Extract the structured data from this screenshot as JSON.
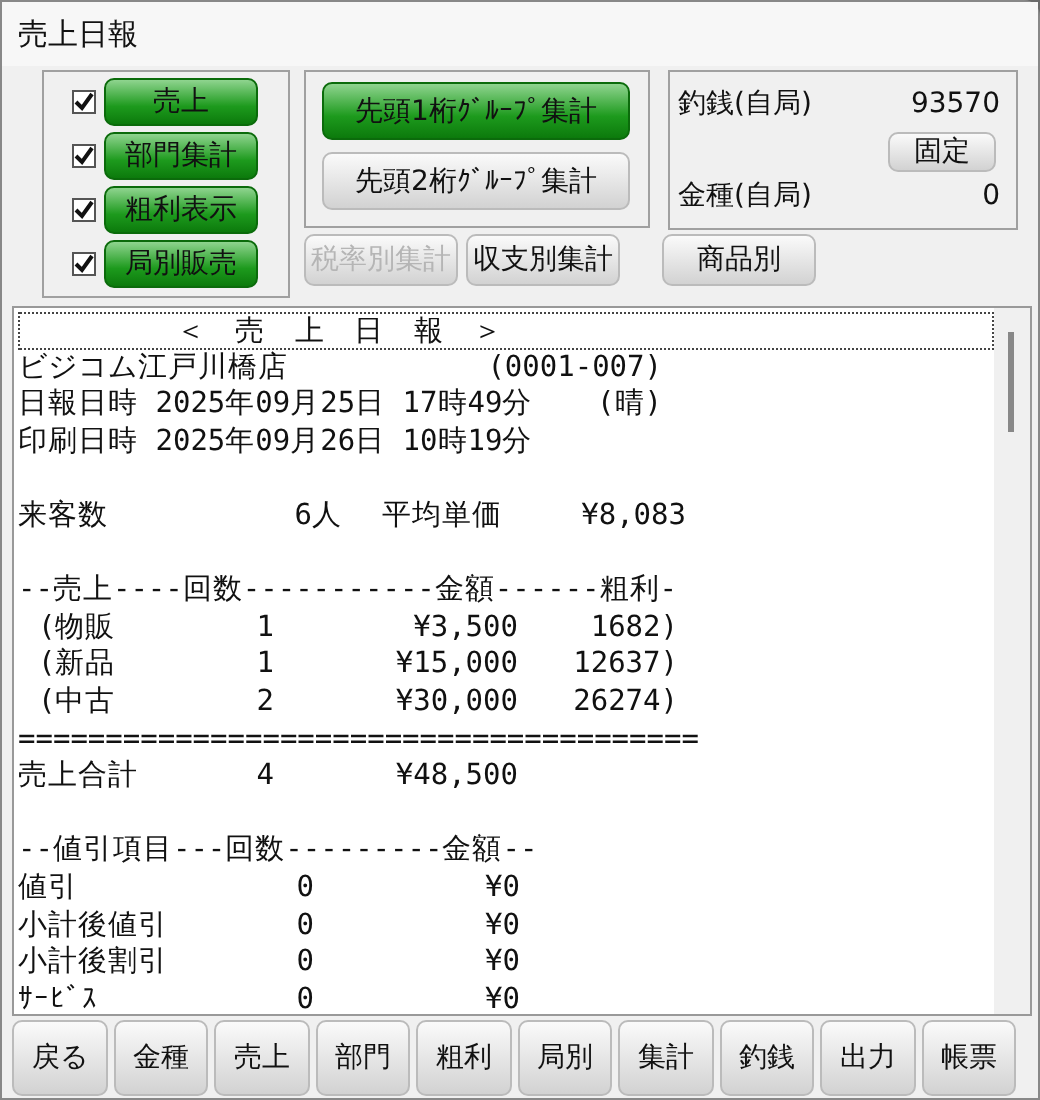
{
  "window": {
    "title": "売上日報"
  },
  "options": [
    {
      "label": "売上",
      "checked": true,
      "on": true
    },
    {
      "label": "部門集計",
      "checked": true,
      "on": true
    },
    {
      "label": "粗利表示",
      "checked": true,
      "on": true
    },
    {
      "label": "局別販売",
      "checked": true,
      "on": true
    }
  ],
  "group_buttons": [
    {
      "label": "先頭1桁ｸﾞﾙｰﾌﾟ集計",
      "on": true
    },
    {
      "label": "先頭2桁ｸﾞﾙｰﾌﾟ集計",
      "on": false
    }
  ],
  "sub_buttons": [
    {
      "label": "税率別集計",
      "disabled": true
    },
    {
      "label": "収支別集計",
      "disabled": false
    },
    {
      "label": "商品別",
      "disabled": false
    }
  ],
  "cash_panel": {
    "change_label": "釣銭(自局)",
    "change_value": "93570",
    "fix_button": "固定",
    "denom_label": "金種(自局)",
    "denom_value": "0"
  },
  "report": [
    {
      "kind": "title",
      "text": "＜ 売 上 日 報 ＞"
    },
    {
      "kind": "pair",
      "left": "ビジコム江戸川橋店",
      "right": "(0001-007)"
    },
    {
      "kind": "pair",
      "left": "日報日時 2025年09月25日 17時49分",
      "right": "(晴)"
    },
    {
      "kind": "text",
      "text": "印刷日時 2025年09月26日 10時19分"
    },
    {
      "kind": "blank"
    },
    {
      "kind": "visitors",
      "cells": [
        "来客数",
        "6人",
        "平均単価",
        "¥8,083"
      ]
    },
    {
      "kind": "blank"
    },
    {
      "kind": "text",
      "text": "--売上----回数-----------金額------粗利-"
    },
    {
      "kind": "item",
      "cells": [
        "(物販",
        "1",
        "¥3,500",
        "1682)"
      ]
    },
    {
      "kind": "item",
      "cells": [
        "(新品",
        "1",
        "¥15,000",
        "12637)"
      ]
    },
    {
      "kind": "item",
      "cells": [
        "(中古",
        "2",
        "¥30,000",
        "26274)"
      ]
    },
    {
      "kind": "text",
      "text": "======================================="
    },
    {
      "kind": "total",
      "cells": [
        "売上合計",
        "4",
        "¥48,500"
      ]
    },
    {
      "kind": "blank"
    },
    {
      "kind": "text",
      "text": "--値引項目---回数---------金額--"
    },
    {
      "kind": "discount",
      "cells": [
        "値引",
        "0",
        "¥0"
      ]
    },
    {
      "kind": "discount",
      "cells": [
        "小計後値引",
        "0",
        "¥0"
      ]
    },
    {
      "kind": "discount",
      "cells": [
        "小計後割引",
        "0",
        "¥0"
      ]
    },
    {
      "kind": "discount",
      "cells": [
        "ｻｰﾋﾞｽ",
        "0",
        "¥0"
      ]
    }
  ],
  "bottom_buttons": [
    "戻る",
    "金種",
    "売上",
    "部門",
    "粗利",
    "局別",
    "集計",
    "釣銭",
    "出力",
    "帳票"
  ]
}
